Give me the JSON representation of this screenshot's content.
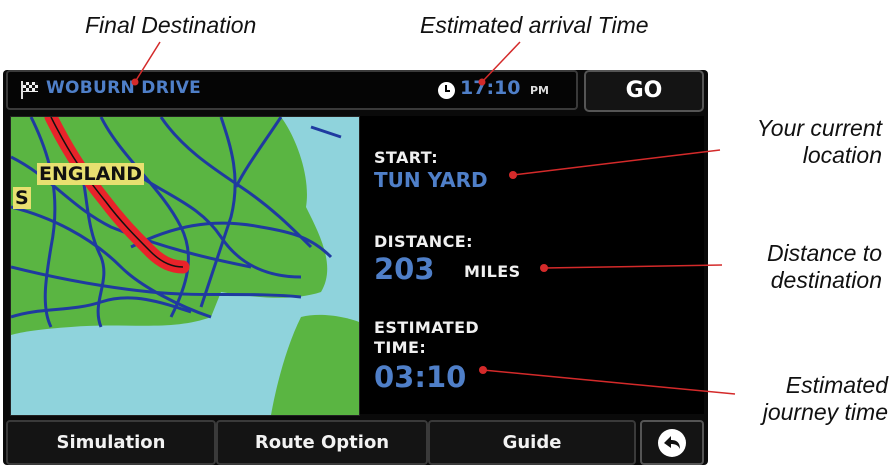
{
  "callouts": {
    "final_destination": "Final Destination",
    "estimated_arrival": "Estimated arrival Time",
    "current_location": [
      "Your current",
      "location"
    ],
    "distance_to_dest": [
      "Distance to",
      "destination"
    ],
    "journey_time": [
      "Estimated",
      "journey time"
    ]
  },
  "header": {
    "destination": "WOBURN DRIVE",
    "arrival_time": "17:10",
    "ampm": "PM",
    "go_label": "GO"
  },
  "map": {
    "region_label": "ENGLAND",
    "edge_label": "S"
  },
  "info": {
    "start_label": "START:",
    "start_value": "TUN YARD",
    "distance_label": "DISTANCE:",
    "distance_value": "203",
    "distance_unit": "MILES",
    "est_label_1": "ESTIMATED",
    "est_label_2": "TIME:",
    "est_value": "03:10"
  },
  "footer": {
    "simulation": "Simulation",
    "route_option": "Route Option",
    "guide": "Guide"
  },
  "colors": {
    "accent_blue": "#4f7fc8",
    "route_red": "#e8232a",
    "land_green": "#5ab542",
    "sea_blue": "#8fd3dc"
  }
}
